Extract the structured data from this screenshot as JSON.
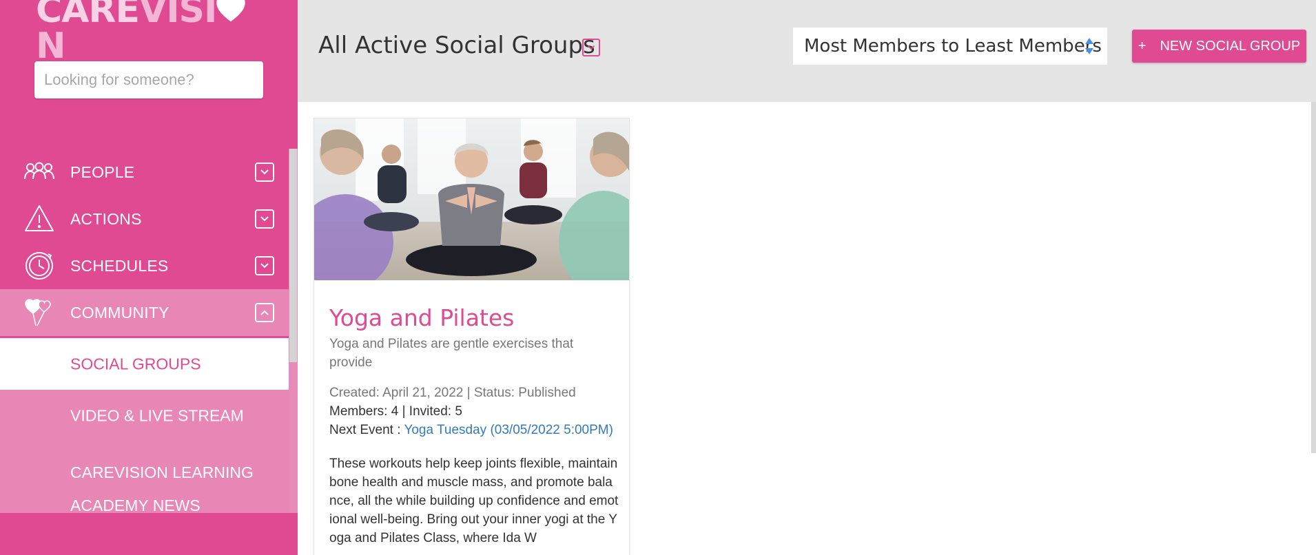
{
  "brand": {
    "logo_part1": "CARE",
    "logo_part2": "VISI",
    "logo_part3": "N",
    "primary_color": "#df4a92",
    "accent_light": "#e886b6"
  },
  "search": {
    "placeholder": "Looking for someone?"
  },
  "nav": {
    "people": {
      "label": "PEOPLE",
      "icon": "people-icon"
    },
    "actions": {
      "label": "ACTIONS",
      "icon": "warning-icon"
    },
    "schedules": {
      "label": "SCHEDULES",
      "icon": "clock-icon"
    },
    "community": {
      "label": "COMMUNITY",
      "icon": "heart-balloons-icon"
    },
    "sub": {
      "social_groups": "SOCIAL GROUPS",
      "video": "VIDEO & LIVE STREAM",
      "learning": "CAREVISION LEARNING ACADEMY NEWS"
    }
  },
  "header": {
    "title": "All Active Social Groups",
    "sort_selected": "Most Members to Least Members",
    "new_button_plus": "+",
    "new_button_label": "NEW SOCIAL GROUP"
  },
  "card": {
    "title": "Yoga and Pilates",
    "description": "Yoga and Pilates are gentle exercises that provide",
    "meta": "Created: April 21, 2022 | Status: Published",
    "members": "Members: 4 | Invited: 5",
    "next_event_label": "Next Event : ",
    "next_event_link": "Yoga Tuesday (03/05/2022 5:00PM)",
    "long_text": "These workouts help keep joints flexible, maintain bone health and muscle mass, and promote balance, all the while building up confidence and emotional well-being. Bring out your inner yogi at the Yoga and Pilates Class, where Ida W"
  }
}
